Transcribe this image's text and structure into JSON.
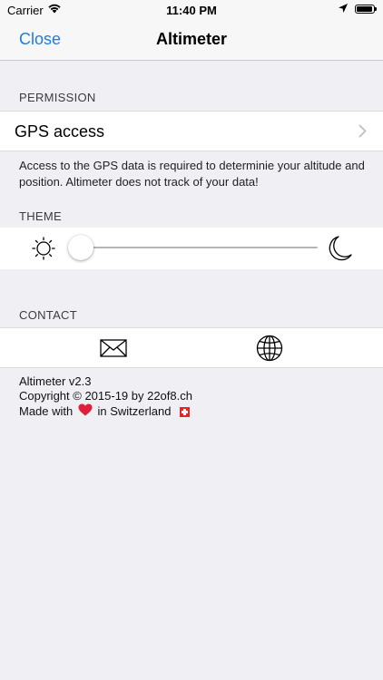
{
  "status_bar": {
    "carrier": "Carrier",
    "time": "11:40 PM"
  },
  "nav": {
    "close_label": "Close",
    "title": "Altimeter"
  },
  "permission": {
    "header": "PERMISSION",
    "gps_label": "GPS access",
    "footer": "Access to the GPS data is required to determinie your altitude and position. Altimeter does not track of your data!"
  },
  "theme": {
    "header": "THEME",
    "slider_value": 0
  },
  "contact": {
    "header": "CONTACT"
  },
  "about": {
    "version": "Altimeter v2.3",
    "copyright": "Copyright © 2015-19 by 22of8.ch",
    "made_prefix": "Made with",
    "made_suffix": "in Switzerland"
  },
  "colors": {
    "accent": "#1f7ce0",
    "background": "#efeff4",
    "heart": "#e0203a"
  },
  "icons": {
    "sun": "sun-icon",
    "moon": "moon-icon",
    "mail": "mail-icon",
    "globe": "globe-icon",
    "chevron": "chevron-right-icon"
  }
}
